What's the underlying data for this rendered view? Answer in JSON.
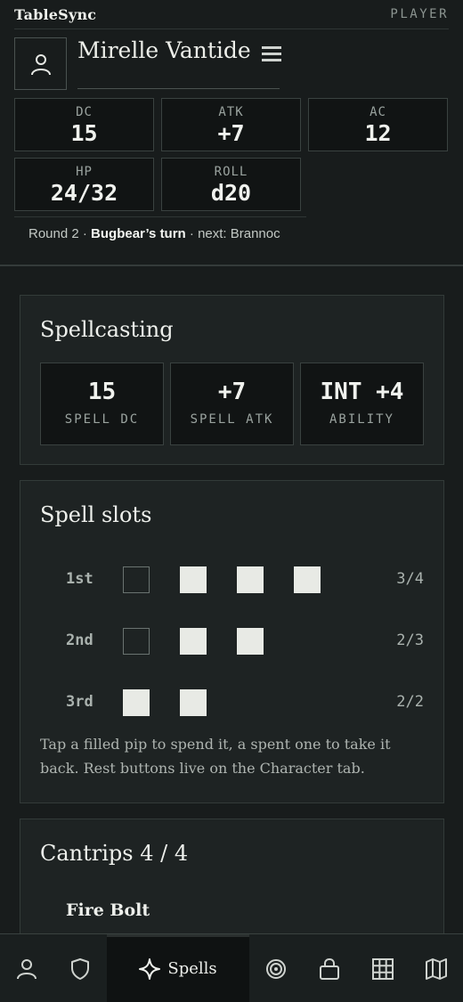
{
  "app": {
    "brand": "TableSync",
    "role": "PLAYER"
  },
  "character": {
    "name": "Mirelle Vantide"
  },
  "stats": [
    {
      "label": "DC",
      "value": "15"
    },
    {
      "label": "ATK",
      "value": "+7"
    },
    {
      "label": "AC",
      "value": "12"
    },
    {
      "label": "HP",
      "value": "24/32"
    },
    {
      "label": "ROLL",
      "value": "d20"
    }
  ],
  "round": {
    "prefix": "Round 2 · ",
    "turn": "Bugbear’s turn",
    "next": " · next: Brannoc"
  },
  "spellcasting": {
    "title": "Spellcasting",
    "boxes": [
      {
        "value": "15",
        "label": "SPELL DC"
      },
      {
        "value": "+7",
        "label": "SPELL ATK"
      },
      {
        "value": "INT +4",
        "label": "ABILITY"
      }
    ]
  },
  "spell_slots": {
    "title": "Spell slots",
    "rows": [
      {
        "level": "1st",
        "count": "3/4",
        "pips": [
          "empty",
          "filled",
          "filled",
          "filled"
        ]
      },
      {
        "level": "2nd",
        "count": "2/3",
        "pips": [
          "empty",
          "filled",
          "filled"
        ]
      },
      {
        "level": "3rd",
        "count": "2/2",
        "pips": [
          "filled",
          "filled"
        ]
      }
    ],
    "note": "Tap a filled pip to spend it, a spent one to take it back. Rest buttons live on the Character tab."
  },
  "cantrips": {
    "title": "Cantrips 4 / 4",
    "first_item": "Fire Bolt"
  },
  "nav": {
    "items": [
      {
        "icon": "person-icon"
      },
      {
        "icon": "shield-icon"
      },
      {
        "icon": "sparkle-icon",
        "label": "Spells",
        "active": true
      },
      {
        "icon": "target-icon"
      },
      {
        "icon": "bag-icon"
      },
      {
        "icon": "grid-icon"
      },
      {
        "icon": "map-icon"
      }
    ]
  }
}
